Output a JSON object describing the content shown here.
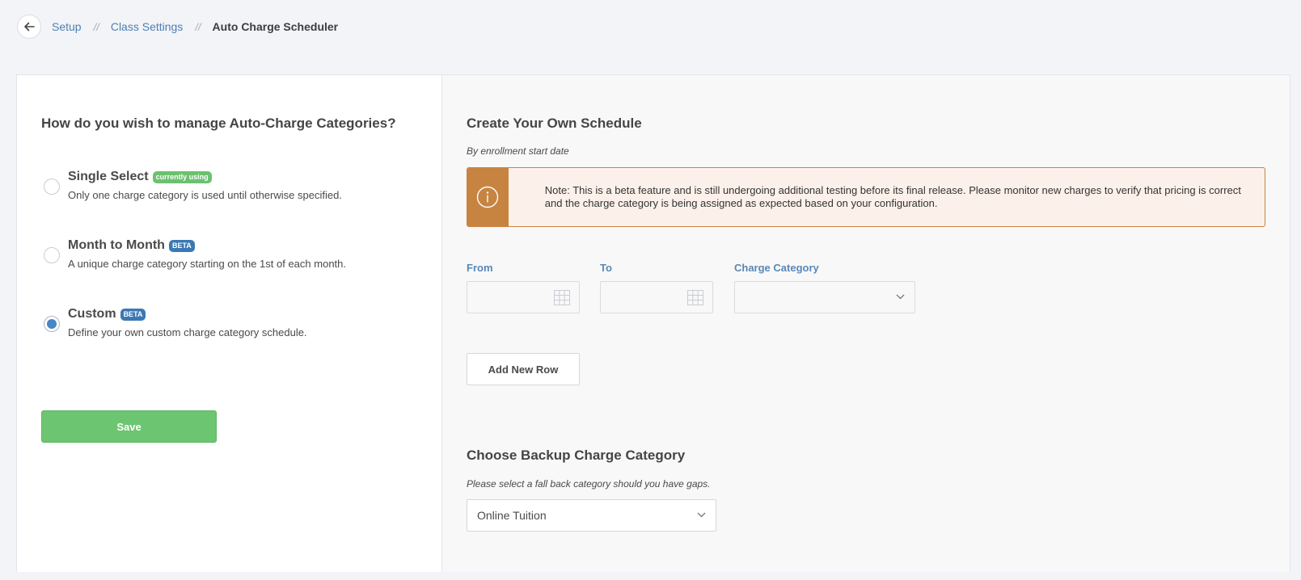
{
  "breadcrumb": {
    "items": [
      "Setup",
      "Class Settings"
    ],
    "separator": "//",
    "current": "Auto Charge Scheduler"
  },
  "left": {
    "title": "How do you wish to manage Auto-Charge Categories?",
    "options": [
      {
        "label": "Single Select",
        "badge": "currently using",
        "badge_color": "#6cc16f",
        "description": "Only one charge category is used until otherwise specified.",
        "selected": false
      },
      {
        "label": "Month to Month",
        "badge": "BETA",
        "badge_color": "#3b78b4",
        "description": "A unique charge category starting on the 1st of each month.",
        "selected": false
      },
      {
        "label": "Custom",
        "badge": "BETA",
        "badge_color": "#3b78b4",
        "description": "Define your own custom charge category schedule.",
        "selected": true
      }
    ],
    "save_label": "Save"
  },
  "right": {
    "title": "Create Your Own Schedule",
    "subtitle": "By enrollment start date",
    "note": "Note: This is a beta feature and is still undergoing additional testing before its final release. Please monitor new charges to verify that pricing is correct and the charge category is being assigned as expected based on your configuration.",
    "fields": {
      "from_label": "From",
      "to_label": "To",
      "category_label": "Charge Category",
      "from_value": "",
      "to_value": "",
      "category_value": ""
    },
    "add_row_label": "Add New Row",
    "backup": {
      "title": "Choose Backup Charge Category",
      "subtitle": "Please select a fall back category should you have gaps.",
      "selected": "Online Tuition"
    }
  },
  "colors": {
    "accent_blue": "#4a86c5",
    "save_green": "#6cc570",
    "note_orange": "#c78441",
    "note_bg": "#fcf1ea"
  },
  "icons": [
    "back-arrow-icon",
    "info-icon",
    "calendar-icon",
    "chevron-down-icon"
  ]
}
